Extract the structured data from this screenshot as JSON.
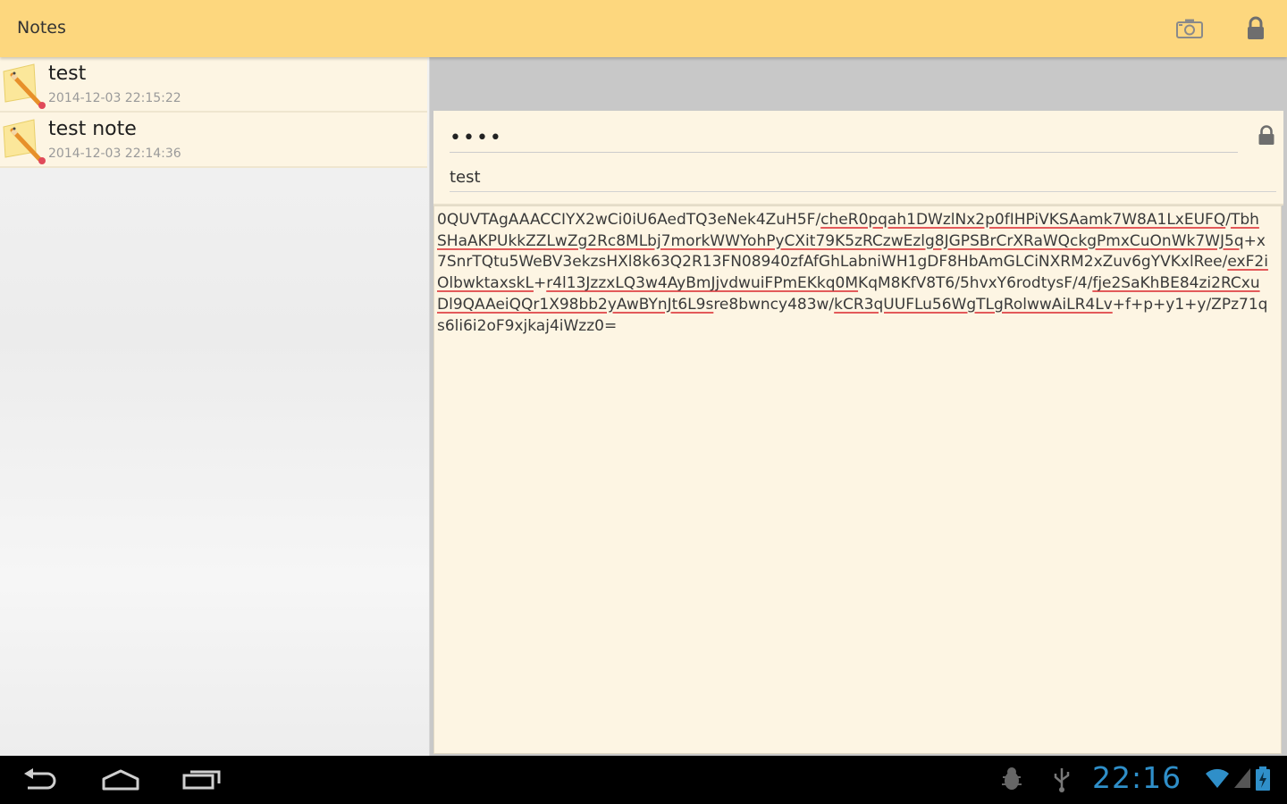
{
  "app": {
    "title": "Notes",
    "icons": {
      "camera": "camera-icon",
      "lock": "lock-icon"
    },
    "colors": {
      "actionbar": "#fdd77e",
      "item_bg": "#fdf5e3",
      "clock": "#2f8fc9",
      "spellcheck": "#e35a5a"
    }
  },
  "notes": [
    {
      "title": "test",
      "date": "2014-12-03 22:15:22",
      "icon": "note-pencil-icon"
    },
    {
      "title": "test note",
      "date": "2014-12-03 22:14:36",
      "icon": "note-pencil-icon"
    }
  ],
  "detail": {
    "password_value": "••••",
    "title_value": "test",
    "content_segments": [
      {
        "text": "0QUVTAgAAACCIYX2wCi0iU6AedTQ3eNek4ZuH5F/",
        "flag": false
      },
      {
        "text": "cheR0pqah1DWzlNx2p0fIHPiVKSAamk7W8A1LxEUFQ",
        "flag": true
      },
      {
        "text": "/",
        "flag": false
      },
      {
        "text": "TbhSHaAKPUkkZZLwZg2Rc8MLbj7morkWWYohPyCXit79K5zRCzwEzlg8JGPSBrCrXRaWQckgPmxCuOnWk7WJ5q",
        "flag": true
      },
      {
        "text": "+x7SnrTQtu5WeBV3ekzsHXl8k63Q2R13FN08940zfAfGhLabniWH1gDF8HbAmGLCiNXRM2xZuv6gYVKxlRee/",
        "flag": false
      },
      {
        "text": "exF2iOlbwktaxskL",
        "flag": true
      },
      {
        "text": "+",
        "flag": false
      },
      {
        "text": "r4l13JzzxLQ3w4AyBmJjvdwuiFPmEKkq0M",
        "flag": true
      },
      {
        "text": "KqM8KfV8T6/5hvxY6rodtysF/4/",
        "flag": false
      },
      {
        "text": "fje2SaKhBE84zi2RCxuDl9QAAeiQQr1X98bb2yAwBYnJt6L9s",
        "flag": true
      },
      {
        "text": "re8bwncy483w/",
        "flag": false
      },
      {
        "text": "kCR3qUUFLu56WgTLgRolwwAiLR4Lv",
        "flag": true
      },
      {
        "text": "+f+p+y1+y/ZPz71qs6li6i2oF9xjkaj4iWzz0=",
        "flag": false
      }
    ]
  },
  "system": {
    "clock": "22:16",
    "nav": {
      "back": "back-icon",
      "home": "home-icon",
      "recents": "recent-apps-icon"
    },
    "status": [
      "debug-icon",
      "usb-icon",
      "wifi-icon",
      "signal-icon",
      "battery-icon"
    ]
  }
}
